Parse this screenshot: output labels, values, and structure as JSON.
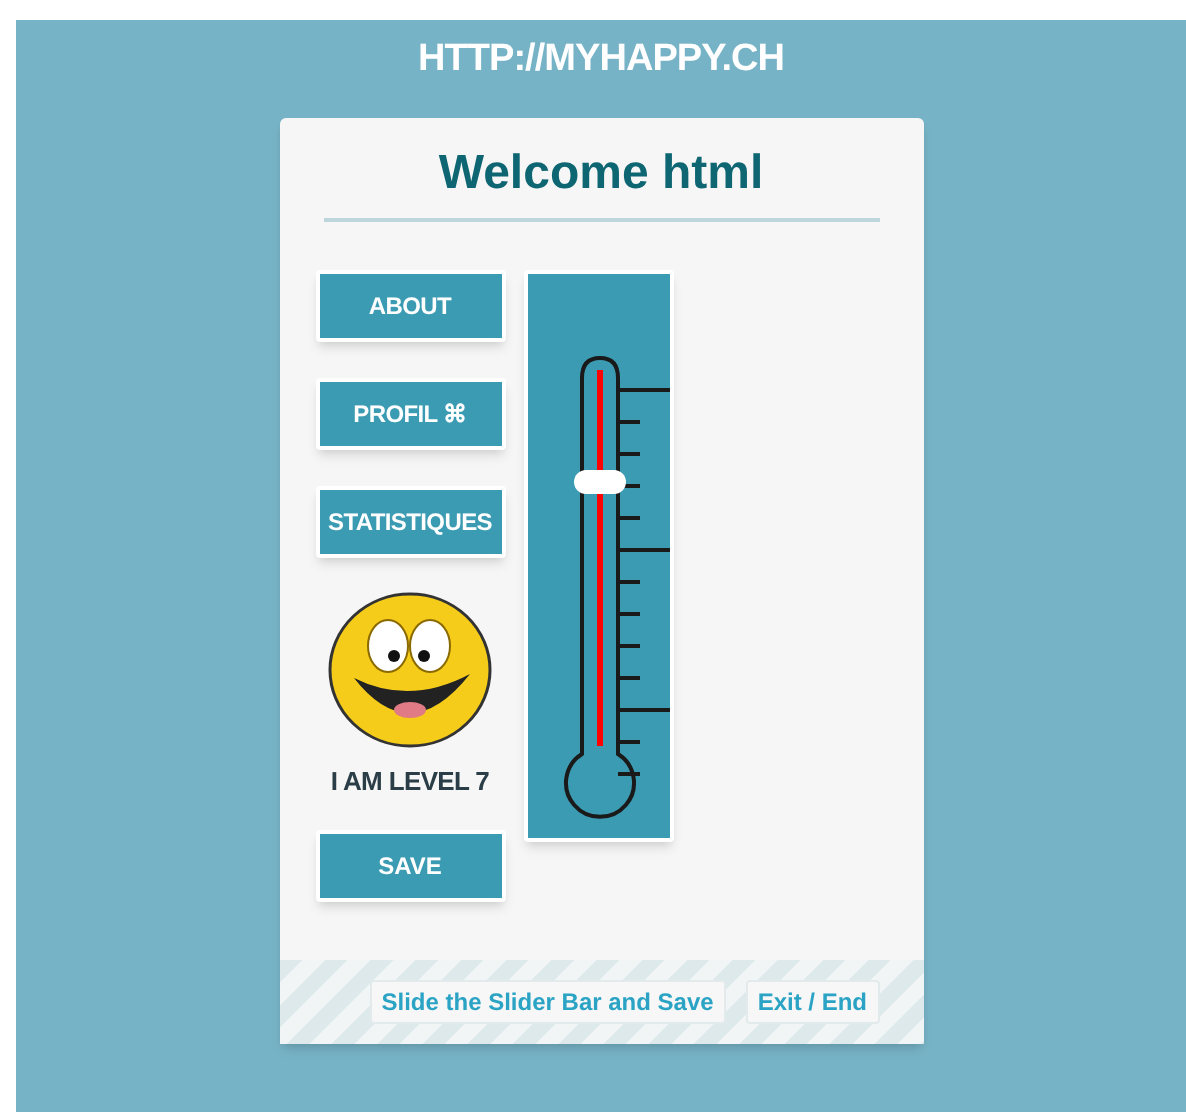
{
  "header": {
    "title": "HTTP://MYHAPPY.CH"
  },
  "card": {
    "title": "Welcome html",
    "buttons": [
      {
        "label": "ABOUT"
      },
      {
        "label": "PROFIL ⌘"
      },
      {
        "label": "STATISTIQUES"
      }
    ],
    "level_label": "I AM LEVEL 7",
    "save_button": "SAVE",
    "slider": {
      "level": 0.7
    },
    "footer_links": [
      "Slide the Slider Bar and Save",
      "Exit / End"
    ]
  }
}
